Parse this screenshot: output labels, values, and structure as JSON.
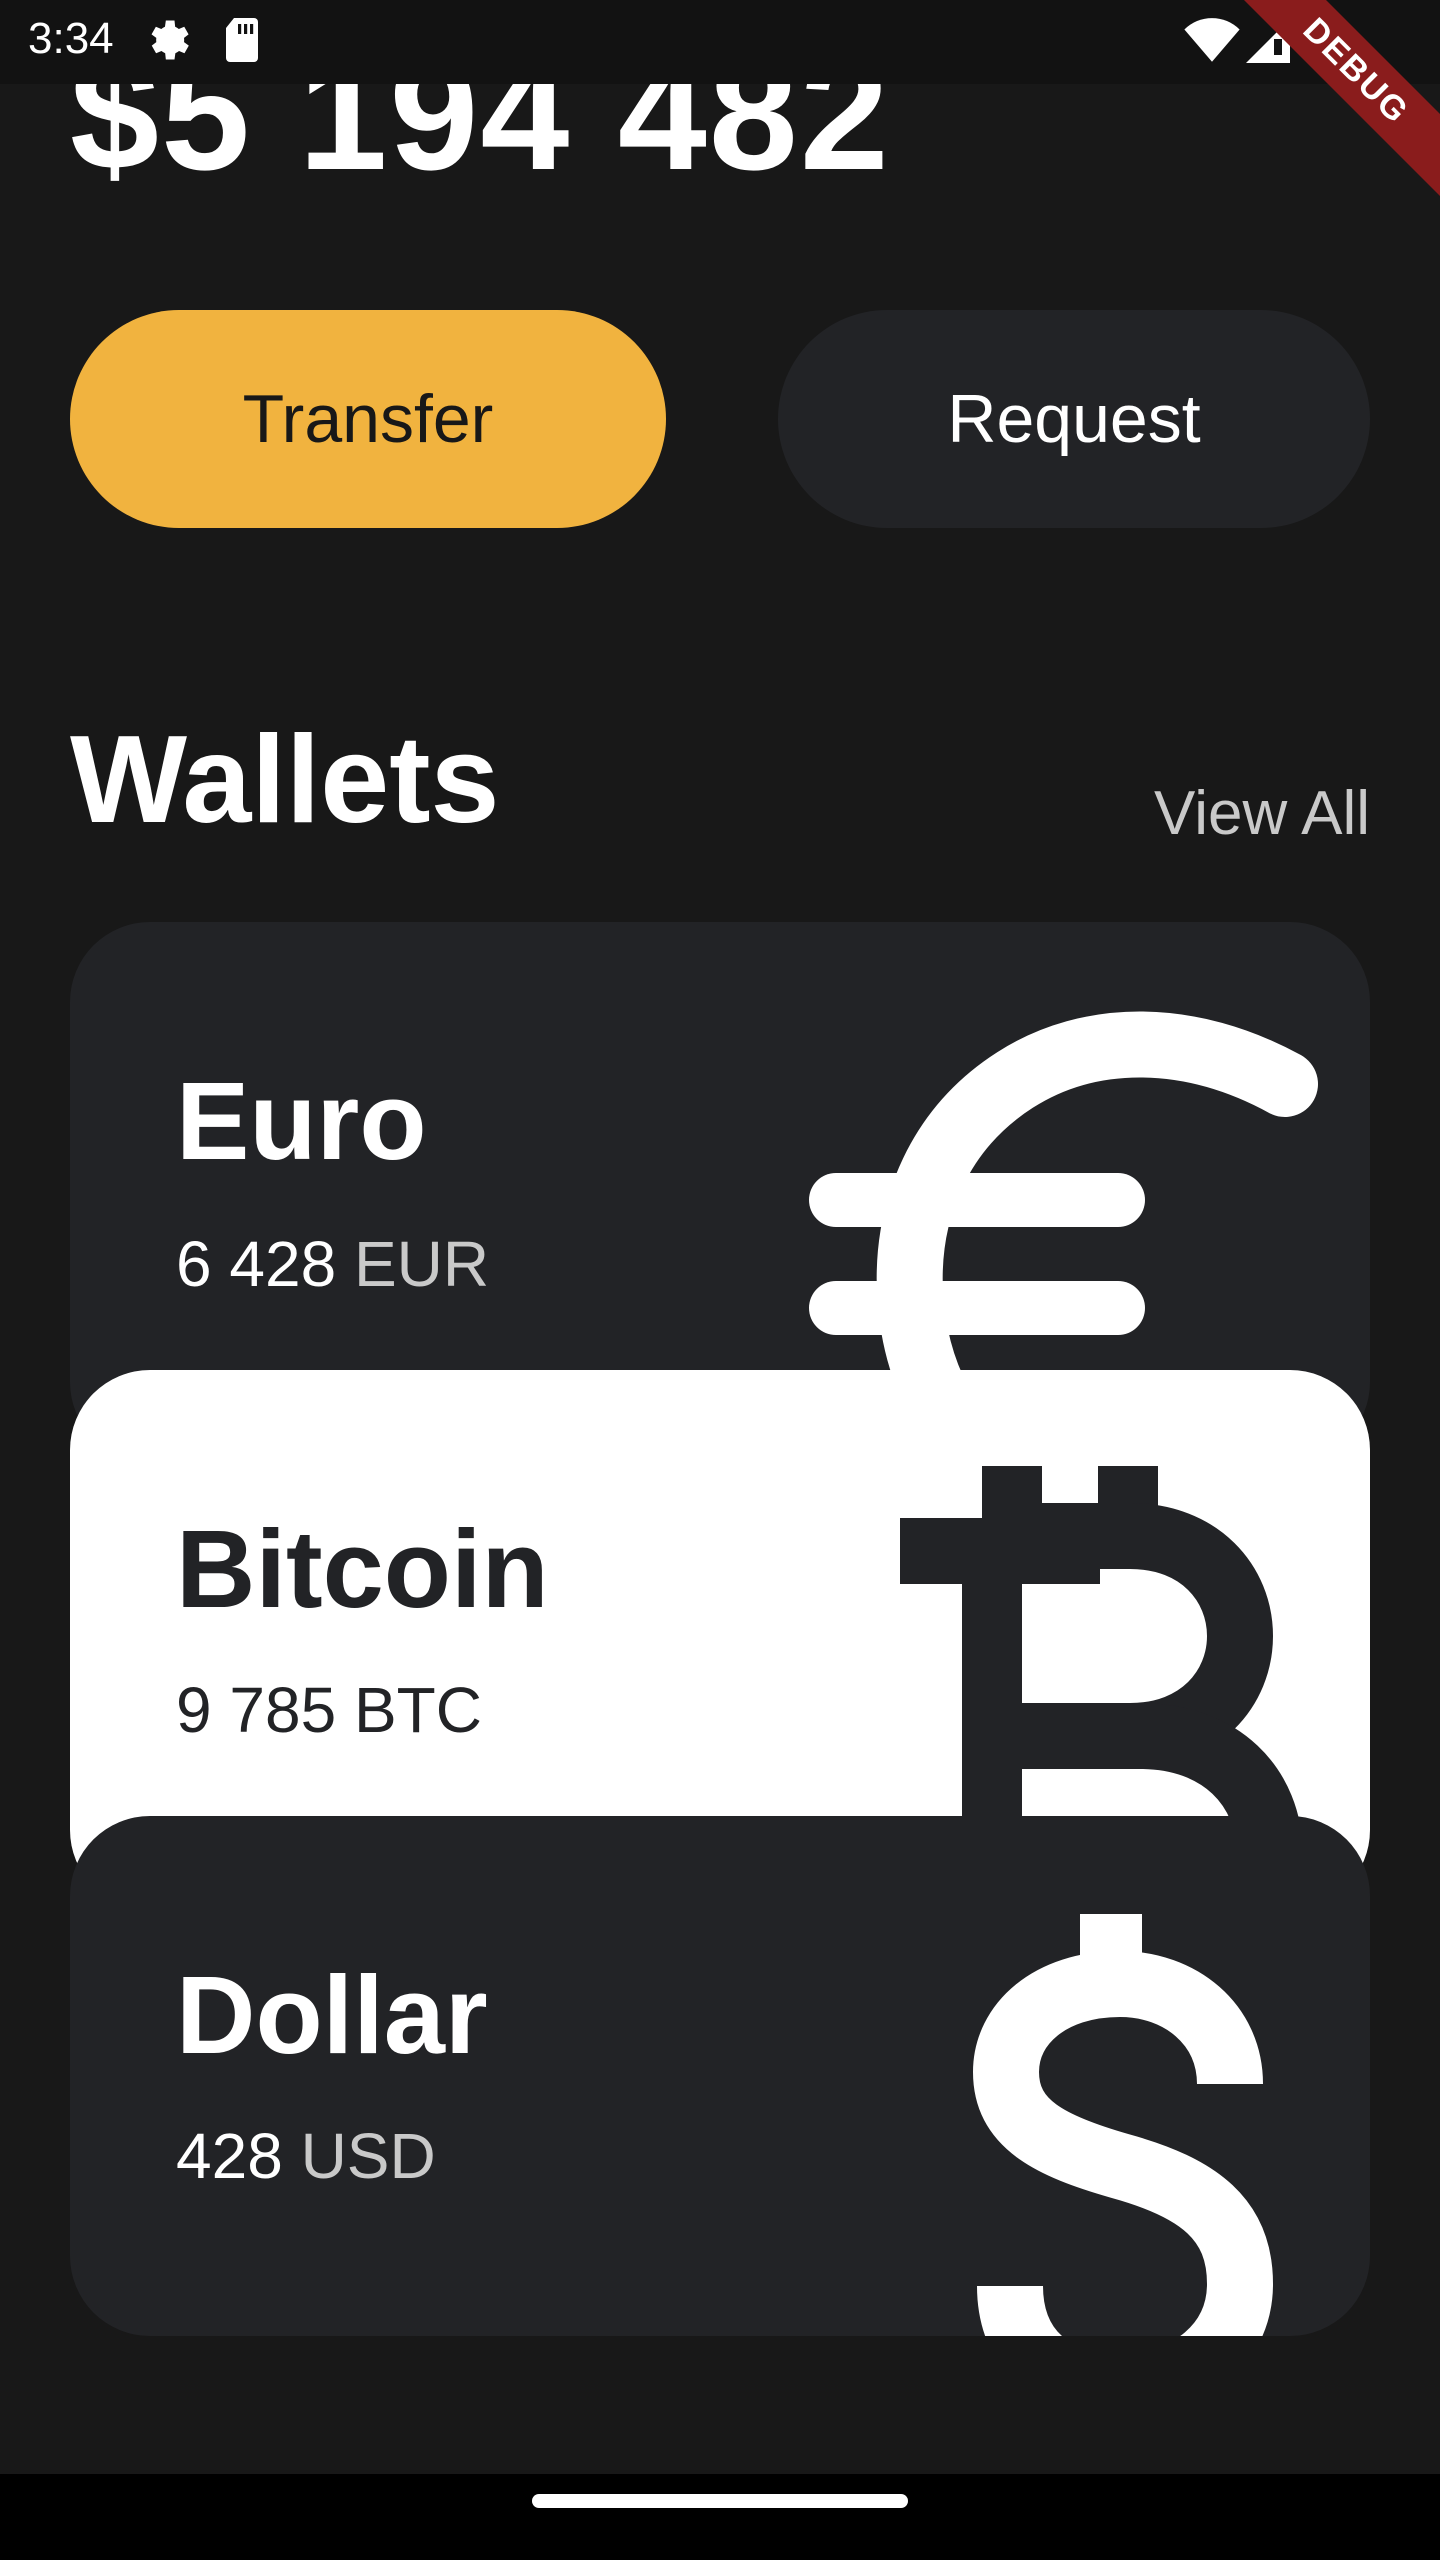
{
  "status_bar": {
    "time": "3:34",
    "icons": [
      "settings-icon",
      "sd-card-icon",
      "wifi-icon",
      "signal-icon",
      "battery-icon"
    ]
  },
  "debug_banner": "DEBUG",
  "balance": "$5 194 482",
  "actions": {
    "transfer_label": "Transfer",
    "request_label": "Request"
  },
  "wallets": {
    "title": "Wallets",
    "view_all_label": "View All",
    "items": [
      {
        "name": "Euro",
        "amount": "6 428",
        "unit": "EUR",
        "icon": "euro-icon"
      },
      {
        "name": "Bitcoin",
        "amount": "9 785",
        "unit": "BTC",
        "icon": "bitcoin-icon"
      },
      {
        "name": "Dollar",
        "amount": "428",
        "unit": "USD",
        "icon": "dollar-icon"
      }
    ]
  },
  "colors": {
    "background": "#181818",
    "card": "#222326",
    "accent": "#f1b33f",
    "highlight_card": "#ffffff",
    "muted_text": "#c9c9c9"
  }
}
